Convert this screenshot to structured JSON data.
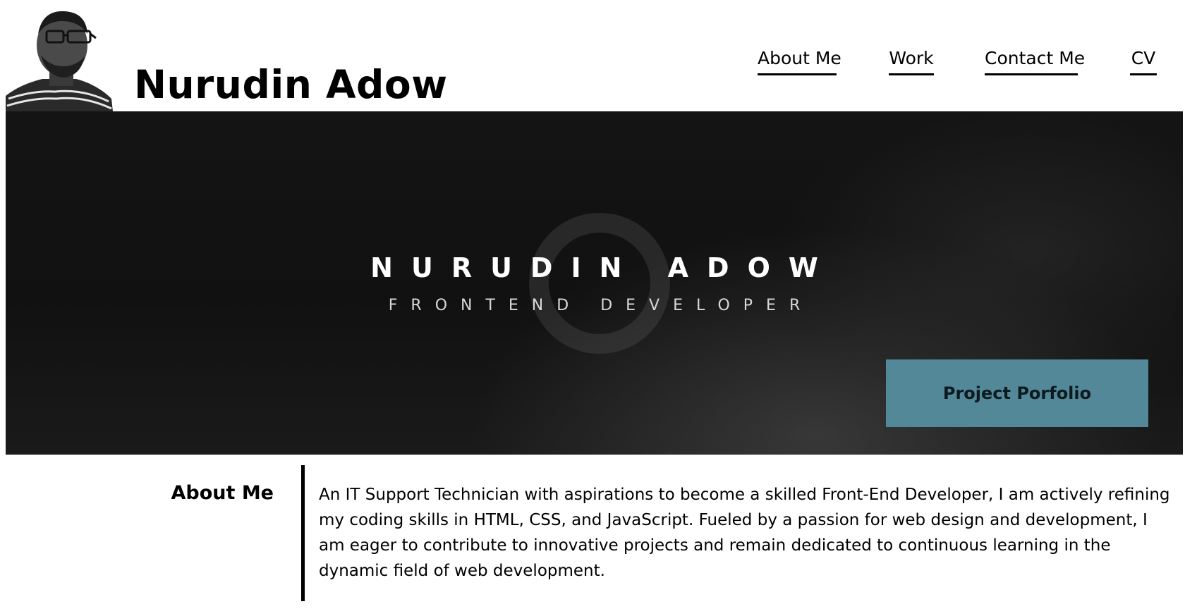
{
  "header": {
    "title": "Nurudin Adow",
    "avatar_alt": "Nurudin Adow portrait"
  },
  "nav": {
    "items": [
      {
        "label": "About Me"
      },
      {
        "label": "Work"
      },
      {
        "label": "Contact Me"
      },
      {
        "label": "CV"
      }
    ]
  },
  "hero": {
    "name": "NURUDIN ADOW",
    "role": "FRONTEND DEVELOPER",
    "button_label": "Project Porfolio",
    "button_color": "#538899",
    "background_color": "#141414"
  },
  "about": {
    "heading": "About Me",
    "body": "An IT Support Technician with aspirations to become a skilled Front-End Developer, I am actively refining my coding skills in HTML, CSS, and JavaScript. Fueled by a passion for web design and development, I am eager to contribute to innovative projects and remain dedicated to continuous learning in the dynamic field of web development."
  }
}
